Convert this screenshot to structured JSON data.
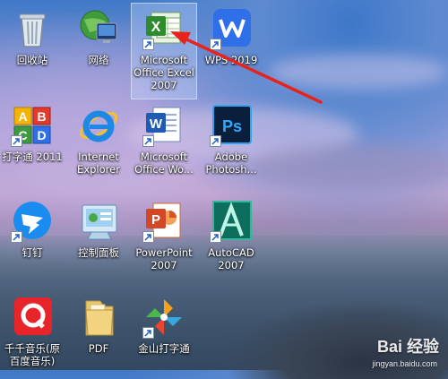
{
  "desktop": {
    "icons": [
      {
        "label": "回收站"
      },
      {
        "label": "网络"
      },
      {
        "label": "Microsoft\nOffice Excel\n2007"
      },
      {
        "label": "WPS 2019"
      },
      {
        "label": "打字通 2011"
      },
      {
        "label": "Internet\nExplorer"
      },
      {
        "label": "Microsoft\nOffice Wo..."
      },
      {
        "label": "Adobe\nPhotosh..."
      },
      {
        "label": "钉钉"
      },
      {
        "label": "控制面板"
      },
      {
        "label": "PowerPoint\n2007"
      },
      {
        "label": "AutoCAD\n2007"
      },
      {
        "label": "千千音乐(原\n百度音乐)"
      },
      {
        "label": "PDF"
      },
      {
        "label": "金山打字通"
      }
    ],
    "selected_icon": "Microsoft Office Excel 2007",
    "annotation_arrow_color": "#e8231d"
  },
  "watermark": {
    "main": "Bai 经验",
    "sub": "jingyan.baidu.com"
  }
}
